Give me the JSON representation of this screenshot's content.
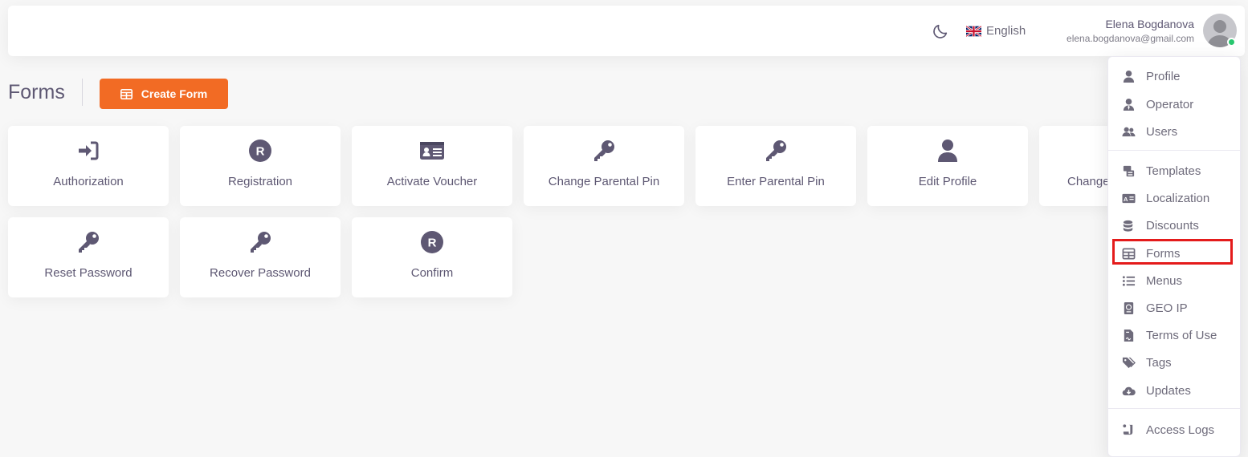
{
  "header": {
    "theme_icon": "moon-icon",
    "language": {
      "label": "English",
      "icon": "uk-flag-icon"
    },
    "user": {
      "name": "Elena Bogdanova",
      "email": "elena.bogdanova@gmail.com",
      "status": "online"
    }
  },
  "page": {
    "title": "Forms",
    "create_button": {
      "label": "Create Form",
      "icon": "table-icon"
    }
  },
  "forms": [
    {
      "label": "Authorization",
      "icon": "sign-in-icon"
    },
    {
      "label": "Registration",
      "icon": "registered-icon"
    },
    {
      "label": "Activate Voucher",
      "icon": "id-card-icon"
    },
    {
      "label": "Change Parental Pin",
      "icon": "key-icon"
    },
    {
      "label": "Enter Parental Pin",
      "icon": "key-icon"
    },
    {
      "label": "Edit Profile",
      "icon": "user-icon"
    },
    {
      "label": "Change",
      "icon": "key-icon"
    },
    {
      "label": "Reset Password",
      "icon": "key-icon"
    },
    {
      "label": "Recover Password",
      "icon": "key-icon"
    },
    {
      "label": "Confirm",
      "icon": "registered-icon"
    }
  ],
  "menu": {
    "items": [
      {
        "label": "Profile",
        "icon": "user-icon"
      },
      {
        "label": "Operator",
        "icon": "user-tie-icon"
      },
      {
        "label": "Users",
        "icon": "users-icon"
      },
      {
        "label": "Templates",
        "icon": "templates-icon"
      },
      {
        "label": "Localization",
        "icon": "language-icon"
      },
      {
        "label": "Discounts",
        "icon": "coins-icon"
      },
      {
        "label": "Forms",
        "icon": "table-icon",
        "highlighted": true
      },
      {
        "label": "Menus",
        "icon": "list-icon"
      },
      {
        "label": "GEO IP",
        "icon": "passport-icon"
      },
      {
        "label": "Terms of Use",
        "icon": "file-contract-icon"
      },
      {
        "label": "Tags",
        "icon": "tags-icon"
      },
      {
        "label": "Updates",
        "icon": "cloud-download-icon"
      },
      {
        "label": "Access Logs",
        "icon": "scroll-icon"
      }
    ]
  },
  "colors": {
    "accent": "#f26b24",
    "icon": "#6e6b7b",
    "highlight": "#e41b1b",
    "online": "#28c76f",
    "background": "#f7f7f7"
  }
}
